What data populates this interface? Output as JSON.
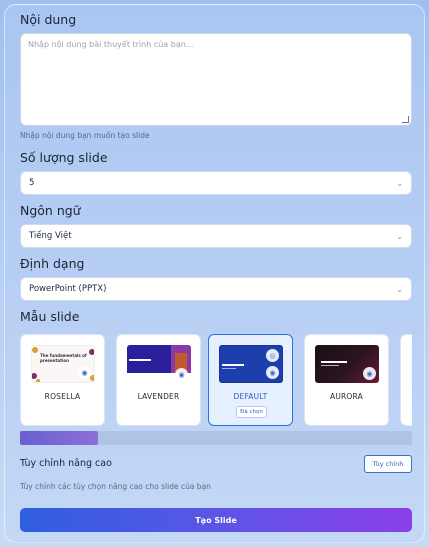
{
  "content": {
    "label": "Nội dung",
    "placeholder": "Nhập nội dung bài thuyết trình của bạn...",
    "hint": "Nhập nội dung bạn muốn tạo slide"
  },
  "slide_count": {
    "label": "Số lượng slide",
    "value": "5"
  },
  "language": {
    "label": "Ngôn ngữ",
    "value": "Tiếng Việt"
  },
  "format": {
    "label": "Định dạng",
    "value": "PowerPoint (PPTX)"
  },
  "templates": {
    "label": "Mẫu slide",
    "items": [
      {
        "name": "ROSELLA",
        "thumb_text": "The fundamentals of presentation",
        "selected": false
      },
      {
        "name": "LAVENDER",
        "thumb_text": "",
        "selected": false
      },
      {
        "name": "DEFAULT",
        "thumb_text": "",
        "selected": true,
        "badge": "Đã chọn"
      },
      {
        "name": "AURORA",
        "thumb_text": "",
        "selected": false
      }
    ]
  },
  "advanced": {
    "label": "Tùy chỉnh nâng cao",
    "button_label": "Tùy chỉnh",
    "hint": "Tùy chỉnh các tùy chọn nâng cao cho slide của bạn"
  },
  "create_button": "Tạo Slide",
  "colors": {
    "accent": "#2f6fe0",
    "button_gradient_start": "#2f5fe0",
    "button_gradient_end": "#8b3fe6"
  }
}
